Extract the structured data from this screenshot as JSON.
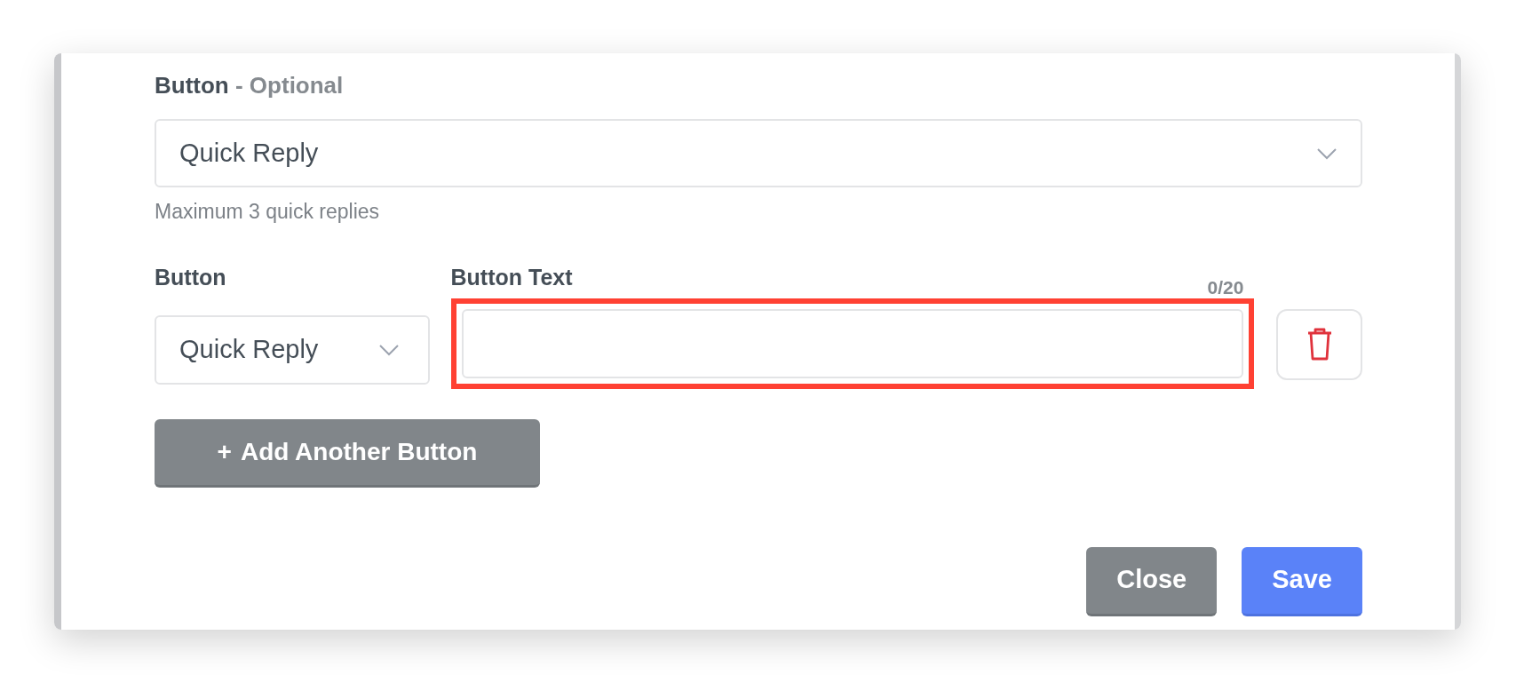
{
  "optional_section": {
    "label": "Button",
    "suffix": "- Optional",
    "select": {
      "value": "Quick Reply"
    },
    "help": "Maximum 3 quick replies"
  },
  "button_row": {
    "type_label": "Button",
    "type_select": {
      "value": "Quick Reply"
    },
    "text_label": "Button Text",
    "counter": "0/20",
    "text_field": {
      "highlighted": true
    }
  },
  "add_button": {
    "icon": "+",
    "label": "Add Another Button"
  },
  "footer_buttons": [
    {
      "label": "Close",
      "kind": "secondary"
    },
    {
      "label": "Save",
      "kind": "primary"
    }
  ]
}
